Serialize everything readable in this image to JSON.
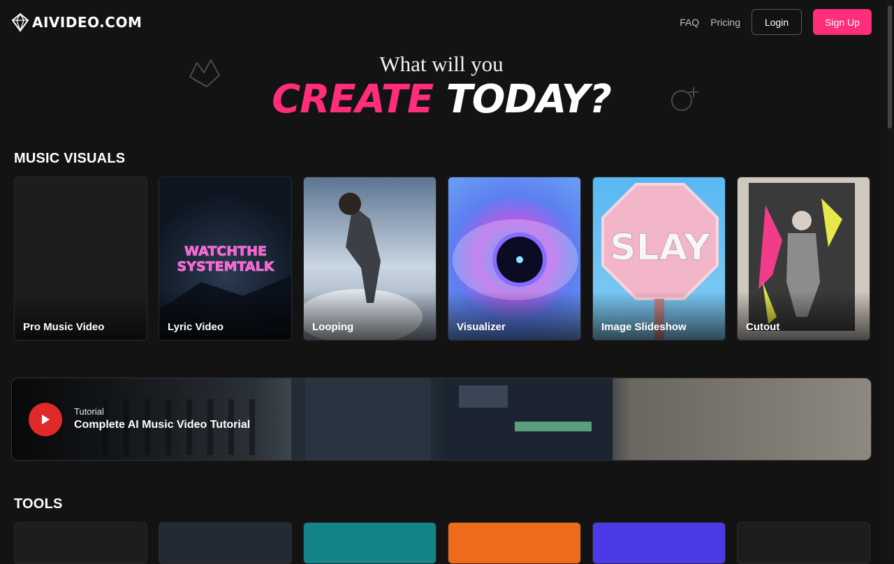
{
  "header": {
    "logo_text": "AIVIDEO.COM",
    "nav": {
      "faq": "FAQ",
      "pricing": "Pricing",
      "login": "Login",
      "signup": "Sign Up"
    }
  },
  "hero": {
    "line1": "What will you",
    "create": "CREATE",
    "today": "TODAY?"
  },
  "music_visuals": {
    "title": "MUSIC VISUALS",
    "cards": [
      {
        "label": "Pro Music Video"
      },
      {
        "label": "Lyric Video"
      },
      {
        "label": "Looping"
      },
      {
        "label": "Visualizer"
      },
      {
        "label": "Image Slideshow"
      },
      {
        "label": "Cutout"
      }
    ]
  },
  "banner": {
    "kicker": "Tutorial",
    "title": "Complete AI Music Video Tutorial"
  },
  "tools": {
    "title": "TOOLS"
  },
  "colors": {
    "accent": "#ff2d7a",
    "background": "#131313",
    "play": "#e02929"
  }
}
